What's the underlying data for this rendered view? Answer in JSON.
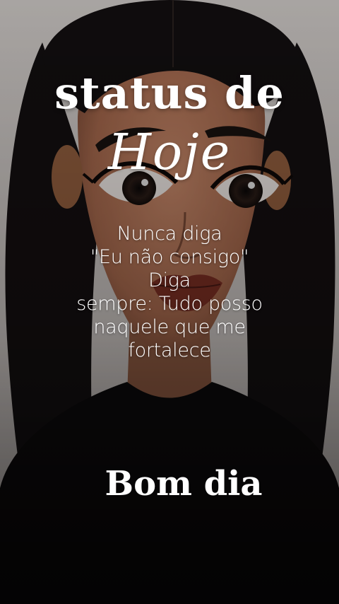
{
  "title": "status de",
  "script_word": "Hoje",
  "quote_lines": [
    "Nunca diga",
    "\"Eu não consigo\"",
    "Diga",
    "sempre: Tudo posso",
    "naquele que me",
    "fortalece"
  ],
  "greeting": "Bom dia",
  "colors": {
    "background": "#cfcac7",
    "hair": "#141011",
    "skin": "#b9775a",
    "shirt": "#0d0b0c",
    "text": "#ffffff"
  }
}
